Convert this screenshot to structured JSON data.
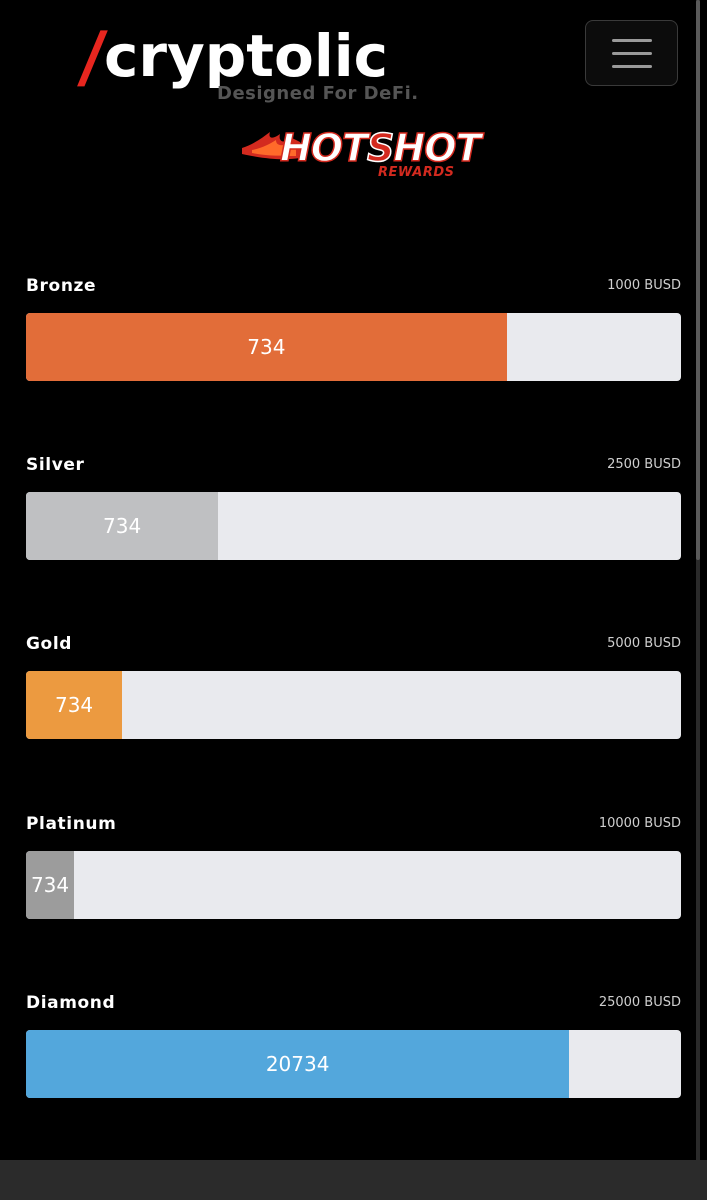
{
  "brand": {
    "slash": "/",
    "name": "cryptolic",
    "tagline": "Designed For DeFi.",
    "hotshot_pre": "HOT",
    "hotshot_s": "S",
    "hotshot_post": "HOT",
    "hotshot_sub": "REWARDS"
  },
  "menu": {
    "icon": "hamburger-icon"
  },
  "colors": {
    "background": "#000000",
    "track": "#e9eaee",
    "bronze": "#e26d39",
    "silver": "#bfc0c2",
    "gold": "#ec9a40",
    "platinum": "#9c9c9c",
    "diamond": "#53a7dc",
    "brand_red": "#e8261f"
  },
  "tiers": [
    {
      "name": "Bronze",
      "target": "1000 BUSD",
      "value_label": "734",
      "progress": 0.734,
      "color": "#e26d39"
    },
    {
      "name": "Silver",
      "target": "2500 BUSD",
      "value_label": "734",
      "progress": 0.2936,
      "color": "#bfc0c2"
    },
    {
      "name": "Gold",
      "target": "5000 BUSD",
      "value_label": "734",
      "progress": 0.1468,
      "color": "#ec9a40"
    },
    {
      "name": "Platinum",
      "target": "10000 BUSD",
      "value_label": "734",
      "progress": 0.0734,
      "color": "#9c9c9c"
    },
    {
      "name": "Diamond",
      "target": "25000 BUSD",
      "value_label": "20734",
      "progress": 0.8294,
      "color": "#53a7dc"
    }
  ]
}
